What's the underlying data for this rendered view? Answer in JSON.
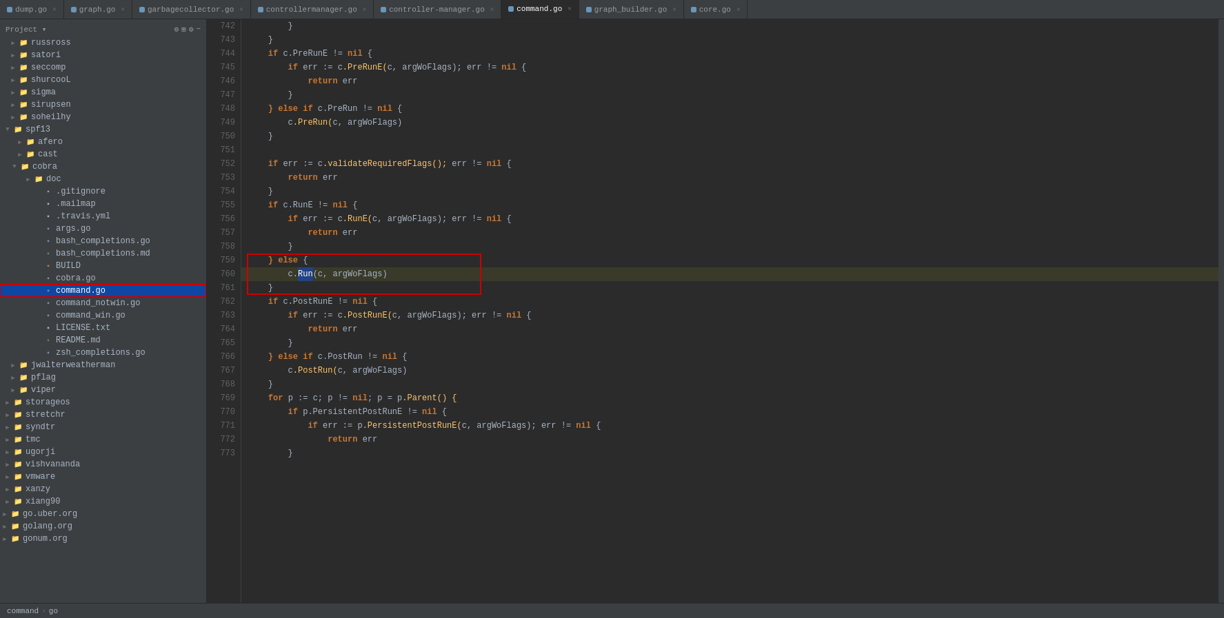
{
  "tabs": [
    {
      "label": "dump.go",
      "active": false,
      "color": "#6897bb"
    },
    {
      "label": "graph.go",
      "active": false,
      "color": "#6897bb"
    },
    {
      "label": "garbagecollector.go",
      "active": false,
      "color": "#6897bb"
    },
    {
      "label": "controllermanager.go",
      "active": false,
      "color": "#6897bb"
    },
    {
      "label": "controller-manager.go",
      "active": false,
      "color": "#6897bb"
    },
    {
      "label": "command.go",
      "active": true,
      "color": "#6897bb"
    },
    {
      "label": "graph_builder.go",
      "active": false,
      "color": "#6897bb"
    },
    {
      "label": "core.go",
      "active": false,
      "color": "#6897bb"
    }
  ],
  "sidebar": {
    "title": "Project",
    "items": [
      {
        "id": "russross",
        "label": "russross",
        "type": "folder",
        "depth": 1,
        "expanded": false
      },
      {
        "id": "satori",
        "label": "satori",
        "type": "folder",
        "depth": 1,
        "expanded": false
      },
      {
        "id": "seccomp",
        "label": "seccomp",
        "type": "folder",
        "depth": 1,
        "expanded": false
      },
      {
        "id": "shurcooL",
        "label": "shurcooL",
        "type": "folder",
        "depth": 1,
        "expanded": false
      },
      {
        "id": "sigma",
        "label": "sigma",
        "type": "folder",
        "depth": 1,
        "expanded": false
      },
      {
        "id": "sirupsen",
        "label": "sirupsen",
        "type": "folder",
        "depth": 1,
        "expanded": false
      },
      {
        "id": "soheilhy",
        "label": "soheilhy",
        "type": "folder",
        "depth": 1,
        "expanded": false
      },
      {
        "id": "spf13",
        "label": "spf13",
        "type": "folder",
        "depth": 1,
        "expanded": true
      },
      {
        "id": "afero",
        "label": "afero",
        "type": "folder",
        "depth": 2,
        "expanded": false
      },
      {
        "id": "cast",
        "label": "cast",
        "type": "folder",
        "depth": 2,
        "expanded": false
      },
      {
        "id": "cobra",
        "label": "cobra",
        "type": "folder",
        "depth": 2,
        "expanded": true
      },
      {
        "id": "doc",
        "label": "doc",
        "type": "folder",
        "depth": 3,
        "expanded": false
      },
      {
        "id": "gitignore",
        "label": ".gitignore",
        "type": "git",
        "depth": 3,
        "expanded": false
      },
      {
        "id": "mailmap",
        "label": ".mailmap",
        "type": "file",
        "depth": 3,
        "expanded": false
      },
      {
        "id": "travisyml",
        "label": ".travis.yml",
        "type": "travis",
        "depth": 3,
        "expanded": false
      },
      {
        "id": "argsgo",
        "label": "args.go",
        "type": "go",
        "depth": 3,
        "expanded": false
      },
      {
        "id": "bashcompletionsgo",
        "label": "bash_completions.go",
        "type": "go",
        "depth": 3,
        "expanded": false
      },
      {
        "id": "bashcompletionsmd",
        "label": "bash_completions.md",
        "type": "md",
        "depth": 3,
        "expanded": false
      },
      {
        "id": "BUILD",
        "label": "BUILD",
        "type": "build",
        "depth": 3,
        "expanded": false
      },
      {
        "id": "cobrego",
        "label": "cobra.go",
        "type": "go",
        "depth": 3,
        "expanded": false
      },
      {
        "id": "commandgo",
        "label": "command.go",
        "type": "go",
        "depth": 3,
        "expanded": false,
        "selected": true
      },
      {
        "id": "commandnotwin",
        "label": "command_notwin.go",
        "type": "go",
        "depth": 3,
        "expanded": false
      },
      {
        "id": "commandwin",
        "label": "command_win.go",
        "type": "go",
        "depth": 3,
        "expanded": false
      },
      {
        "id": "LICENSE",
        "label": "LICENSE.txt",
        "type": "file",
        "depth": 3,
        "expanded": false
      },
      {
        "id": "READMEmd",
        "label": "README.md",
        "type": "md",
        "depth": 3,
        "expanded": false
      },
      {
        "id": "zshcompletions",
        "label": "zsh_completions.go",
        "type": "go",
        "depth": 3,
        "expanded": false
      },
      {
        "id": "jwalterweatherman",
        "label": "jwalterweatherman",
        "type": "folder",
        "depth": 1,
        "expanded": false
      },
      {
        "id": "pflag",
        "label": "pflag",
        "type": "folder",
        "depth": 1,
        "expanded": false
      },
      {
        "id": "viper",
        "label": "viper",
        "type": "folder",
        "depth": 1,
        "expanded": false
      },
      {
        "id": "storageos",
        "label": "storageos",
        "type": "folder",
        "depth": 1,
        "expanded": false
      },
      {
        "id": "stretchr",
        "label": "stretchr",
        "type": "folder",
        "depth": 1,
        "expanded": false
      },
      {
        "id": "syndtr",
        "label": "syndtr",
        "type": "folder",
        "depth": 1,
        "expanded": false
      },
      {
        "id": "tmc",
        "label": "tmc",
        "type": "folder",
        "depth": 1,
        "expanded": false
      },
      {
        "id": "ugorji",
        "label": "ugorji",
        "type": "folder",
        "depth": 1,
        "expanded": false
      },
      {
        "id": "vishvananda",
        "label": "vishvananda",
        "type": "folder",
        "depth": 1,
        "expanded": false
      },
      {
        "id": "vmware",
        "label": "vmware",
        "type": "folder",
        "depth": 1,
        "expanded": false
      },
      {
        "id": "xanzy",
        "label": "xanzy",
        "type": "folder",
        "depth": 1,
        "expanded": false
      },
      {
        "id": "xiang90",
        "label": "xiang90",
        "type": "folder",
        "depth": 1,
        "expanded": false
      },
      {
        "id": "gouber",
        "label": "go.uber.org",
        "type": "folder",
        "depth": 0,
        "expanded": false
      },
      {
        "id": "golang",
        "label": "golang.org",
        "type": "folder",
        "depth": 0,
        "expanded": false
      },
      {
        "id": "gonum",
        "label": "gonum.org",
        "type": "folder",
        "depth": 0,
        "expanded": false
      }
    ]
  },
  "breadcrumb": {
    "parts": [
      "command",
      "go"
    ]
  },
  "code_lines": [
    {
      "num": 742,
      "content": "        }",
      "highlight": false
    },
    {
      "num": 743,
      "content": "    }",
      "highlight": false
    },
    {
      "num": 744,
      "content": "    if c.PreRunE != nil {",
      "highlight": false
    },
    {
      "num": 745,
      "content": "        if err := c.PreRunE(c, argWoFlags); err != nil {",
      "highlight": false
    },
    {
      "num": 746,
      "content": "            return err",
      "highlight": false
    },
    {
      "num": 747,
      "content": "        }",
      "highlight": false
    },
    {
      "num": 748,
      "content": "    } else if c.PreRun != nil {",
      "highlight": false
    },
    {
      "num": 749,
      "content": "        c.PreRun(c, argWoFlags)",
      "highlight": false
    },
    {
      "num": 750,
      "content": "    }",
      "highlight": false
    },
    {
      "num": 751,
      "content": "",
      "highlight": false
    },
    {
      "num": 752,
      "content": "    if err := c.validateRequiredFlags(); err != nil {",
      "highlight": false
    },
    {
      "num": 753,
      "content": "        return err",
      "highlight": false
    },
    {
      "num": 754,
      "content": "    }",
      "highlight": false
    },
    {
      "num": 755,
      "content": "    if c.RunE != nil {",
      "highlight": false
    },
    {
      "num": 756,
      "content": "        if err := c.RunE(c, argWoFlags); err != nil {",
      "highlight": false
    },
    {
      "num": 757,
      "content": "            return err",
      "highlight": false
    },
    {
      "num": 758,
      "content": "        }",
      "highlight": false
    },
    {
      "num": 759,
      "content": "    } else {",
      "highlight": false,
      "red_outline_start": true
    },
    {
      "num": 760,
      "content": "        c.Run(c, argWoFlags)",
      "highlight": true
    },
    {
      "num": 761,
      "content": "    }",
      "highlight": false,
      "red_outline_end": true
    },
    {
      "num": 762,
      "content": "    if c.PostRunE != nil {",
      "highlight": false
    },
    {
      "num": 763,
      "content": "        if err := c.PostRunE(c, argWoFlags); err != nil {",
      "highlight": false
    },
    {
      "num": 764,
      "content": "            return err",
      "highlight": false
    },
    {
      "num": 765,
      "content": "        }",
      "highlight": false
    },
    {
      "num": 766,
      "content": "    } else if c.PostRun != nil {",
      "highlight": false
    },
    {
      "num": 767,
      "content": "        c.PostRun(c, argWoFlags)",
      "highlight": false
    },
    {
      "num": 768,
      "content": "    }",
      "highlight": false
    },
    {
      "num": 769,
      "content": "    for p := c; p != nil; p = p.Parent() {",
      "highlight": false
    },
    {
      "num": 770,
      "content": "        if p.PersistentPostRunE != nil {",
      "highlight": false
    },
    {
      "num": 771,
      "content": "            if err := p.PersistentPostRunE(c, argWoFlags); err != nil {",
      "highlight": false
    },
    {
      "num": 772,
      "content": "                return err",
      "highlight": false
    },
    {
      "num": 773,
      "content": "        }",
      "highlight": false
    }
  ]
}
